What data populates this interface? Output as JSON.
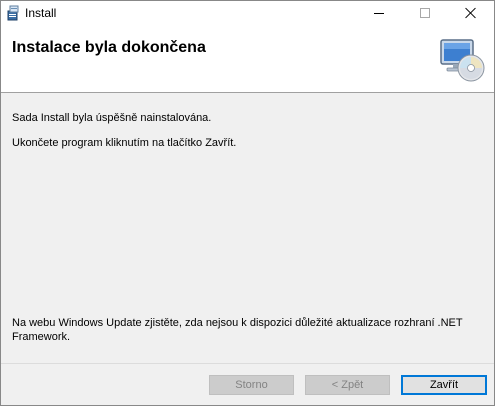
{
  "window": {
    "title": "Install",
    "icons": {
      "app": "installer-icon",
      "minimize": "minimize-icon",
      "maximize": "maximize-icon",
      "close": "close-icon"
    }
  },
  "banner": {
    "title": "Instalace byla dokončena",
    "icon": "cd-monitor-icon"
  },
  "content": {
    "line1": "Sada Install byla úspěšně nainstalována.",
    "line2": "Ukončete program kliknutím na tlačítko Zavřít.",
    "update_note": "Na webu Windows Update zjistěte, zda nejsou k dispozici důležité aktualizace rozhraní .NET Framework."
  },
  "buttons": {
    "cancel": {
      "label": "Storno",
      "enabled": false
    },
    "back": {
      "label": "< Zpět",
      "enabled": false
    },
    "close": {
      "label": "Zavřít",
      "enabled": true
    }
  },
  "colors": {
    "accent": "#0078d7",
    "background": "#f0f0f0",
    "banner": "#ffffff"
  }
}
